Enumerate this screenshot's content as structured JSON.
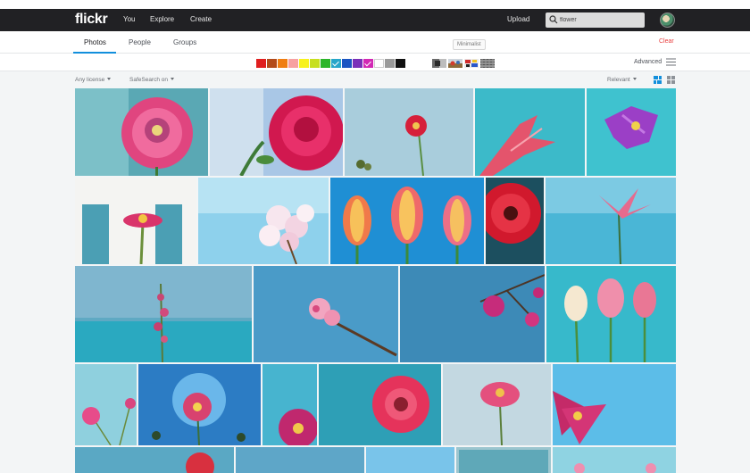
{
  "header": {
    "logo": "flickr",
    "nav": [
      "You",
      "Explore",
      "Create"
    ],
    "upload_label": "Upload",
    "search": {
      "value": "flower",
      "icon": "search-icon"
    }
  },
  "subnav": {
    "tabs": [
      {
        "label": "Photos",
        "active": true
      },
      {
        "label": "People",
        "active": false
      },
      {
        "label": "Groups",
        "active": false
      }
    ],
    "clear_label": "Clear",
    "tooltip": "Minimalist"
  },
  "filters": {
    "colors": [
      "#e01f1f",
      "#b34b1a",
      "#f07e12",
      "#f7a1a1",
      "#f7f21d",
      "#c7df1f",
      "#2cb52a",
      "#27a6c9",
      "#1b55c2",
      "#7a2fb8",
      "#d229b4",
      "#ffffff",
      "#9a9a9a",
      "#111111"
    ],
    "selected_colors": [
      7,
      10
    ],
    "styles": [
      "black-and-white",
      "shallow-depth-of-field",
      "minimalist",
      "patterns"
    ],
    "advanced_label": "Advanced"
  },
  "options": {
    "license": "Any license",
    "safesearch": "SafeSearch on",
    "sort": "Relevant"
  },
  "accent": "#128fdc"
}
